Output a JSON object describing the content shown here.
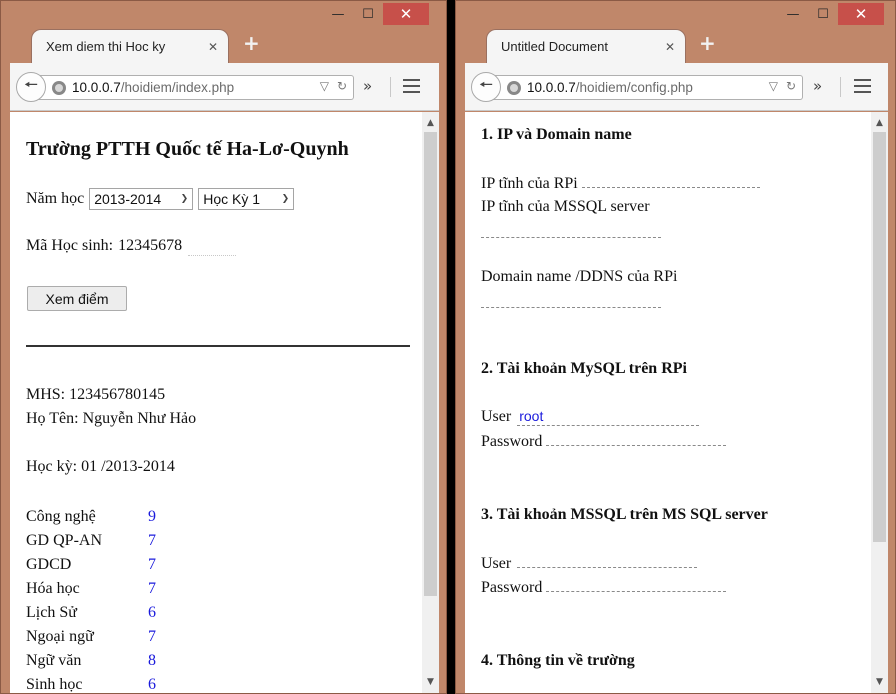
{
  "left": {
    "tab_title": "Xem diem thi Hoc ky",
    "url_host": "10.0.0.7",
    "url_path": "/hoidiem/index.php",
    "heading": "Trường PTTH Quốc tế Ha-Lơ-Quynh",
    "year_label": "Năm học",
    "year_value": "2013-2014",
    "semester_value": "Học Kỳ 1",
    "student_id_label": "Mã Học sinh:",
    "student_id_value": "12345678",
    "submit_label": "Xem điểm",
    "result": {
      "mhs": "MHS: 123456780145",
      "name": "Họ Tên: Nguyễn Như Hảo",
      "semester": "Học kỳ: 01 /2013-2014"
    },
    "scores": [
      {
        "subject": "Công nghệ",
        "score": "9"
      },
      {
        "subject": "GD QP-AN",
        "score": "7"
      },
      {
        "subject": "GDCD",
        "score": "7"
      },
      {
        "subject": "Hóa học",
        "score": "7"
      },
      {
        "subject": "Lịch Sử",
        "score": "6"
      },
      {
        "subject": "Ngoại ngữ",
        "score": "7"
      },
      {
        "subject": "Ngữ văn",
        "score": "8"
      },
      {
        "subject": "Sinh học",
        "score": "6"
      }
    ]
  },
  "right": {
    "tab_title": "Untitled Document",
    "url_host": "10.0.0.7",
    "url_path": "/hoidiem/config.php",
    "sections": {
      "s1": "1. IP và Domain name",
      "s1_rpi_ip": "IP tĩnh của RPi",
      "s1_mssql_ip": "IP tĩnh của MSSQL server",
      "s1_domain": "Domain name /DDNS của RPi",
      "s2": "2. Tài khoản MySQL trên RPi",
      "s2_user": "User",
      "s2_user_value": "root",
      "s2_password": "Password",
      "s3": "3. Tài khoản MSSQL trên MS SQL server",
      "s3_user": "User",
      "s3_password": "Password",
      "s4": "4. Thông tin về trường"
    }
  },
  "icons": {
    "minimize": "minimize-icon",
    "maximize": "maximize-icon",
    "close": "close-icon",
    "back": "back-arrow-icon",
    "globe": "globe-icon",
    "reload": "reload-icon",
    "menu": "hamburger-menu-icon"
  },
  "colors": {
    "window_frame": "#c0876a",
    "close_button": "#c7504a",
    "score_value": "#1a1adc"
  }
}
